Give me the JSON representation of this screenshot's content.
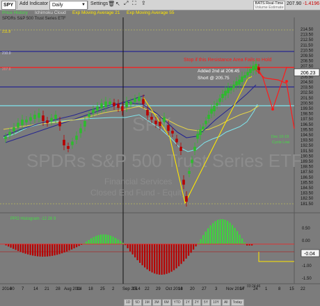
{
  "toolbar": {
    "symbol": "SPY",
    "add_indicator": "Add Indicator",
    "interval": "Daily",
    "settings": "Settings",
    "realtime_line1": "BATS Real-Time",
    "realtime_line2": "Volume Estimate",
    "last_price": "207.90",
    "change": "-1.4196"
  },
  "indicators": {
    "price_history": "Price History",
    "ichimoku": "Ichimoku Cloud",
    "ema21": "Exp Moving Average 21",
    "ema55": "Exp Moving Average 55"
  },
  "instrument": {
    "title_line": "SPDRs S&P 500 Trust Series ETF",
    "watermark_symbol": "SPY",
    "watermark_name": "SPDRs S&P 500 Trust Series ETF",
    "watermark_sector": "Financial Services",
    "watermark_industry": "Closed End Fund - Equity"
  },
  "annotations": {
    "resistance_note": "Stop if this Resistance Area Fails to Hold",
    "entry_note": "Added 2nd at 206.45",
    "short_note": "Short @ 205.75",
    "cycle_note_1": "Dec 10-15",
    "cycle_note_2": "Cycle Low",
    "level_left_1": "211.8",
    "level_left_2": "210.0",
    "level_left_3": "207.8",
    "price_marker": "206.23",
    "ppo_marker": "-0.04",
    "ppo_title": "PPO Histogram -12 26 9",
    "time_marker": "03:24:46"
  },
  "colors": {
    "background": "#7c7c7c",
    "up_candle": "#2dbb2d",
    "down_candle": "#b80000",
    "ema21": "#27278f",
    "ema55": "#e3d24a",
    "ichimoku_base": "#7fe6ee",
    "annotation_red": "#ff1a1a",
    "annotation_yellow": "#ffe600"
  },
  "price_axis": [
    "214.50",
    "213.50",
    "212.50",
    "211.50",
    "210.50",
    "209.50",
    "208.50",
    "207.50",
    "206.50",
    "205.50",
    "204.50",
    "203.50",
    "202.50",
    "201.50",
    "200.50",
    "199.50",
    "198.50",
    "197.50",
    "196.50",
    "195.50",
    "194.50",
    "193.50",
    "192.50",
    "191.50",
    "190.50",
    "189.50",
    "188.50",
    "187.50",
    "186.50",
    "185.50",
    "184.50",
    "183.50",
    "182.50",
    "181.50"
  ],
  "ppo_axis": [
    "0.50",
    "0.00",
    "-0.50",
    "-1.00",
    "-1.50"
  ],
  "date_axis": [
    "2014",
    "30",
    "7",
    "14",
    "21",
    "28",
    "Aug 2014",
    "11",
    "18",
    "25",
    "2",
    "Sep 2014",
    "15",
    "22",
    "29",
    "Oct 2014",
    "13",
    "20",
    "27",
    "3",
    "Nov 2014",
    "17",
    "24",
    "1",
    "8",
    "15",
    "22"
  ],
  "range_buttons": [
    "1D",
    "5D",
    "1M",
    "3M",
    "6M",
    "YTD",
    "1Y",
    "2Y",
    "5Y",
    "10Y",
    "All"
  ],
  "range_selected": "Today"
}
